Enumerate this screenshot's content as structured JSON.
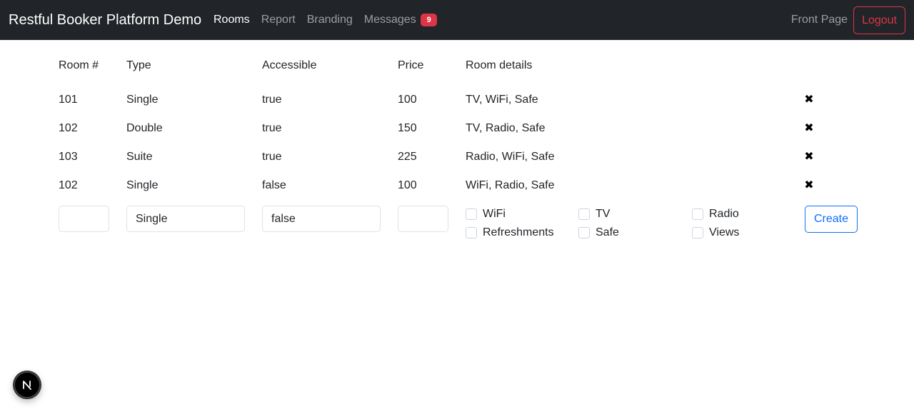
{
  "navbar": {
    "brand": "Restful Booker Platform Demo",
    "links": [
      {
        "label": "Rooms",
        "active": true
      },
      {
        "label": "Report",
        "active": false
      },
      {
        "label": "Branding",
        "active": false
      },
      {
        "label": "Messages",
        "active": false
      }
    ],
    "messages_badge": "9",
    "front_page": "Front Page",
    "logout": "Logout"
  },
  "table": {
    "headers": [
      "Room #",
      "Type",
      "Accessible",
      "Price",
      "Room details"
    ],
    "rows": [
      {
        "room": "101",
        "type": "Single",
        "accessible": "true",
        "price": "100",
        "details": "TV, WiFi, Safe"
      },
      {
        "room": "102",
        "type": "Double",
        "accessible": "true",
        "price": "150",
        "details": "TV, Radio, Safe"
      },
      {
        "room": "103",
        "type": "Suite",
        "accessible": "true",
        "price": "225",
        "details": "Radio, WiFi, Safe"
      },
      {
        "room": "102",
        "type": "Single",
        "accessible": "false",
        "price": "100",
        "details": "WiFi, Radio, Safe"
      }
    ],
    "delete_glyph": "✖"
  },
  "form": {
    "room_number": "",
    "type": "Single",
    "accessible": "false",
    "price": "",
    "features": [
      "WiFi",
      "TV",
      "Radio",
      "Refreshments",
      "Safe",
      "Views"
    ],
    "create": "Create"
  },
  "colors": {
    "navbar_bg": "#212529",
    "danger": "#dc3545",
    "primary": "#0d6efd"
  },
  "icons": {
    "delete": "close-x-icon",
    "dev_badge": "nextjs-logo-icon"
  }
}
